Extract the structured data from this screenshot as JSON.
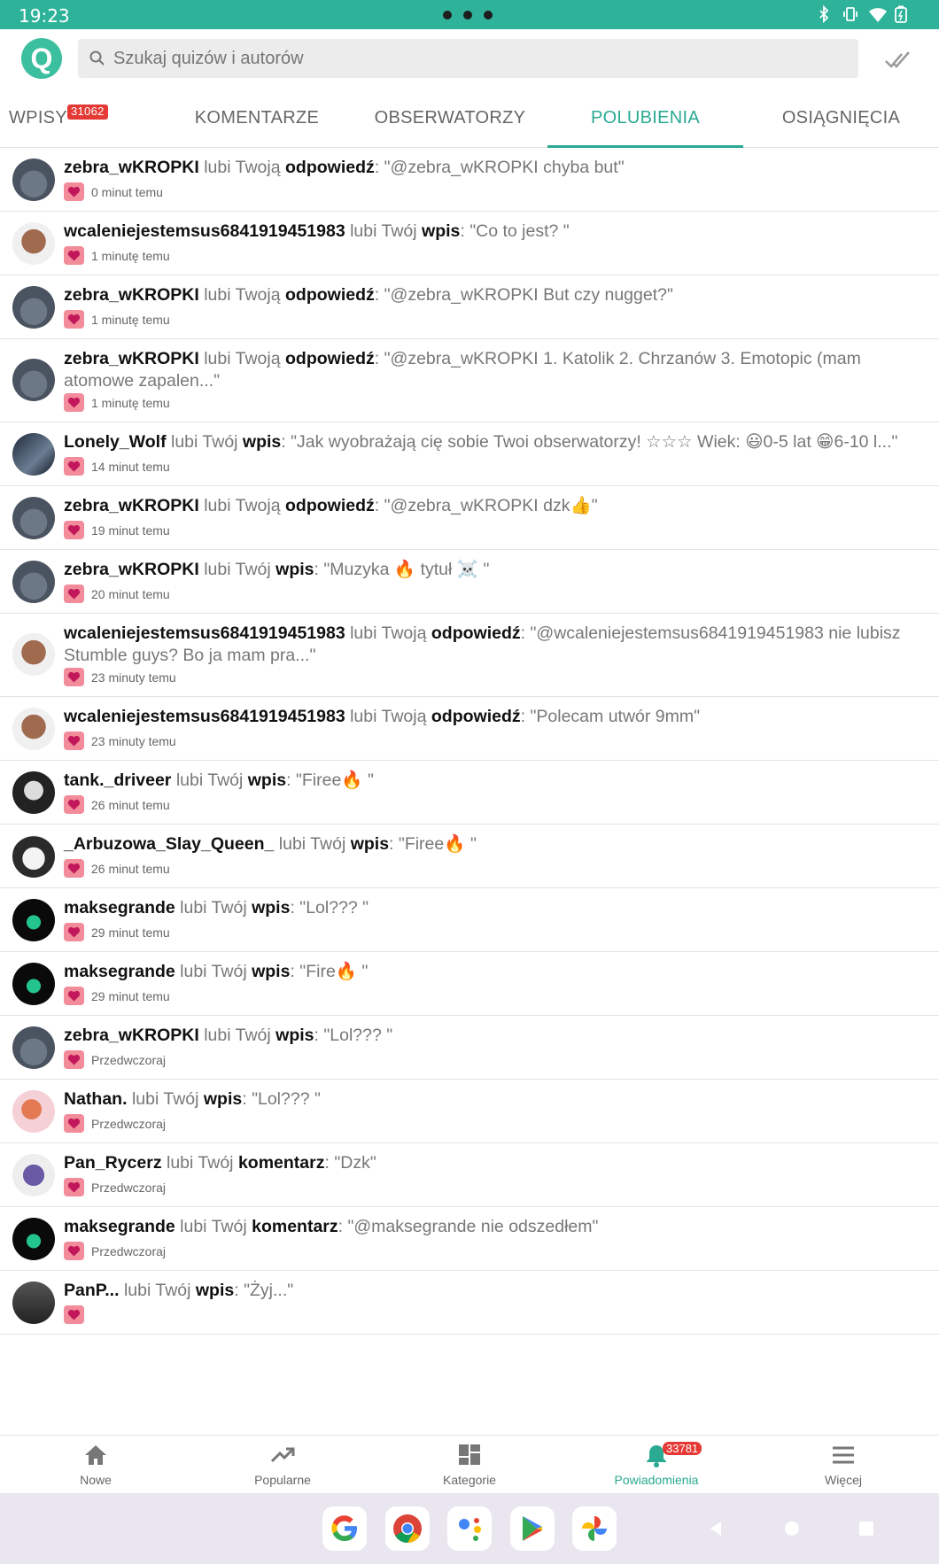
{
  "status": {
    "time": "19:23"
  },
  "search": {
    "placeholder": "Szukaj quizów i autorów",
    "value": ""
  },
  "logo_letter": "Q",
  "tabs": [
    {
      "label": "WPISY",
      "badge": "31062"
    },
    {
      "label": "KOMENTARZE"
    },
    {
      "label": "OBSERWATORZY"
    },
    {
      "label": "POLUBIENIA",
      "active": true
    },
    {
      "label": "OSIĄGNIĘCIA"
    }
  ],
  "notifications": [
    {
      "user": "zebra_wKROPKI",
      "verb": "lubi Twoją",
      "kind": "odpowiedź",
      "text": "\"@zebra_wKROPKI chyba but\"",
      "time": "0 minut temu"
    },
    {
      "user": "wcaleniejestemsus6841919451983",
      "verb": "lubi Twój",
      "kind": "wpis",
      "text": "\"Co to jest? \"",
      "time": "1 minutę temu"
    },
    {
      "user": "zebra_wKROPKI",
      "verb": "lubi Twoją",
      "kind": "odpowiedź",
      "text": "\"@zebra_wKROPKI But czy nugget?\"",
      "time": "1 minutę temu"
    },
    {
      "user": "zebra_wKROPKI",
      "verb": "lubi Twoją",
      "kind": "odpowiedź",
      "text": "\"@zebra_wKROPKI 1. Katolik 2. Chrzanów 3. Emotopic (mam atomowe zapalen...\"",
      "time": "1 minutę temu"
    },
    {
      "user": "Lonely_Wolf",
      "verb": "lubi Twój",
      "kind": "wpis",
      "text": "\"Jak wyobrażają cię sobie Twoi obserwatorzy! ☆☆☆ Wiek: 😃0-5 lat 😁6-10 l...\"",
      "time": "14 minut temu"
    },
    {
      "user": "zebra_wKROPKI",
      "verb": "lubi Twoją",
      "kind": "odpowiedź",
      "text": "\"@zebra_wKROPKI dzk👍\"",
      "time": "19 minut temu"
    },
    {
      "user": "zebra_wKROPKI",
      "verb": "lubi Twój",
      "kind": "wpis",
      "text": "\"Muzyka 🔥 tytuł ☠️ \"",
      "time": "20 minut temu"
    },
    {
      "user": "wcaleniejestemsus6841919451983",
      "verb": "lubi Twoją",
      "kind": "odpowiedź",
      "text": "\"@wcaleniejestemsus6841919451983 nie lubisz Stumble guys? Bo ja mam pra...\"",
      "time": "23 minuty temu"
    },
    {
      "user": "wcaleniejestemsus6841919451983",
      "verb": "lubi Twoją",
      "kind": "odpowiedź",
      "text": "\"Polecam utwór 9mm\"",
      "time": "23 minuty temu"
    },
    {
      "user": "tank._driveer",
      "verb": "lubi Twój",
      "kind": "wpis",
      "text": "\"Firee🔥 \"",
      "time": "26 minut temu"
    },
    {
      "user": "_Arbuzowa_Slay_Queen_",
      "verb": "lubi Twój",
      "kind": "wpis",
      "text": "\"Firee🔥 \"",
      "time": "26 minut temu"
    },
    {
      "user": "maksegrande",
      "verb": "lubi Twój",
      "kind": "wpis",
      "text": "\"Lol??? \"",
      "time": "29 minut temu"
    },
    {
      "user": "maksegrande",
      "verb": "lubi Twój",
      "kind": "wpis",
      "text": "\"Fire🔥 \"",
      "time": "29 minut temu"
    },
    {
      "user": "zebra_wKROPKI",
      "verb": "lubi Twój",
      "kind": "wpis",
      "text": "\"Lol??? \"",
      "time": "Przedwczoraj"
    },
    {
      "user": "Nathan.",
      "verb": "lubi Twój",
      "kind": "wpis",
      "text": "\"Lol??? \"",
      "time": "Przedwczoraj"
    },
    {
      "user": "Pan_Rycerz",
      "verb": "lubi Twój",
      "kind": "komentarz",
      "text": "\"Dzk\"",
      "time": "Przedwczoraj"
    },
    {
      "user": "maksegrande",
      "verb": "lubi Twój",
      "kind": "komentarz",
      "text": "\"@maksegrande nie odszedłem\"",
      "time": "Przedwczoraj"
    },
    {
      "user": "PanP...",
      "verb": "lubi Twój",
      "kind": "wpis",
      "text": "\"Żyj...\"",
      "time": ""
    }
  ],
  "bottom_nav": [
    {
      "label": "Nowe",
      "icon": "home-icon"
    },
    {
      "label": "Popularne",
      "icon": "trending-icon"
    },
    {
      "label": "Kategorie",
      "icon": "dashboard-icon"
    },
    {
      "label": "Powiadomienia",
      "icon": "bell-icon",
      "badge": "33781",
      "active": true
    },
    {
      "label": "Więcej",
      "icon": "menu-icon"
    }
  ],
  "colors": {
    "accent": "#2aaa92",
    "statusbar": "#2eb39a",
    "badge": "#e53935",
    "heart": "#f28b9a"
  }
}
